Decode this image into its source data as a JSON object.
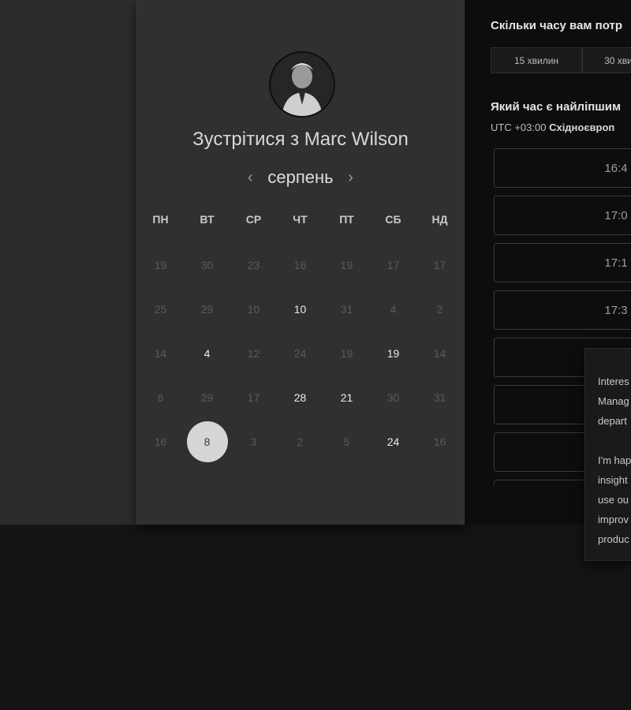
{
  "meeting": {
    "title": "Зустрітися з Marc Wilson",
    "month": "серпень",
    "prev_icon": "chevron-left-icon",
    "next_icon": "chevron-right-icon"
  },
  "calendar": {
    "weekdays": [
      "ПН",
      "ВТ",
      "СР",
      "ЧТ",
      "ПТ",
      "СБ",
      "НД"
    ],
    "weeks": [
      [
        {
          "d": "19",
          "s": "muted"
        },
        {
          "d": "30",
          "s": "muted"
        },
        {
          "d": "23",
          "s": "muted"
        },
        {
          "d": "16",
          "s": "muted"
        },
        {
          "d": "19",
          "s": "muted"
        },
        {
          "d": "17",
          "s": "muted"
        },
        {
          "d": "17",
          "s": "muted"
        }
      ],
      [
        {
          "d": "25",
          "s": "muted"
        },
        {
          "d": "29",
          "s": "muted"
        },
        {
          "d": "10",
          "s": "muted"
        },
        {
          "d": "10",
          "s": "available"
        },
        {
          "d": "31",
          "s": "muted"
        },
        {
          "d": "4",
          "s": "muted"
        },
        {
          "d": "2",
          "s": "muted"
        }
      ],
      [
        {
          "d": "14",
          "s": "muted"
        },
        {
          "d": "4",
          "s": "available"
        },
        {
          "d": "12",
          "s": "muted"
        },
        {
          "d": "24",
          "s": "muted"
        },
        {
          "d": "19",
          "s": "muted"
        },
        {
          "d": "19",
          "s": "available"
        },
        {
          "d": "14",
          "s": "muted"
        }
      ],
      [
        {
          "d": "6",
          "s": "muted"
        },
        {
          "d": "29",
          "s": "muted"
        },
        {
          "d": "17",
          "s": "muted"
        },
        {
          "d": "28",
          "s": "available"
        },
        {
          "d": "21",
          "s": "available"
        },
        {
          "d": "30",
          "s": "muted"
        },
        {
          "d": "31",
          "s": "muted"
        }
      ],
      [
        {
          "d": "16",
          "s": "muted"
        },
        {
          "d": "8",
          "s": "selected"
        },
        {
          "d": "3",
          "s": "muted"
        },
        {
          "d": "2",
          "s": "muted"
        },
        {
          "d": "5",
          "s": "muted"
        },
        {
          "d": "24",
          "s": "available"
        },
        {
          "d": "16",
          "s": "muted"
        }
      ]
    ]
  },
  "scheduler": {
    "duration_title": "Скільки часу вам потр",
    "durations": [
      "15 хвилин",
      "30 хви"
    ],
    "time_title": "Який час є найліпшим",
    "timezone_offset": "UTC +03:00",
    "timezone_name": "Східноєвроп",
    "slots": [
      "16:4",
      "17:0",
      "17:1",
      "17:3",
      "",
      "",
      "",
      ""
    ]
  },
  "tooltip": {
    "text": "Interes\nManag\ndepart\n\nI'm hap\ninsight\nuse ou\nimprov\nproduc"
  }
}
